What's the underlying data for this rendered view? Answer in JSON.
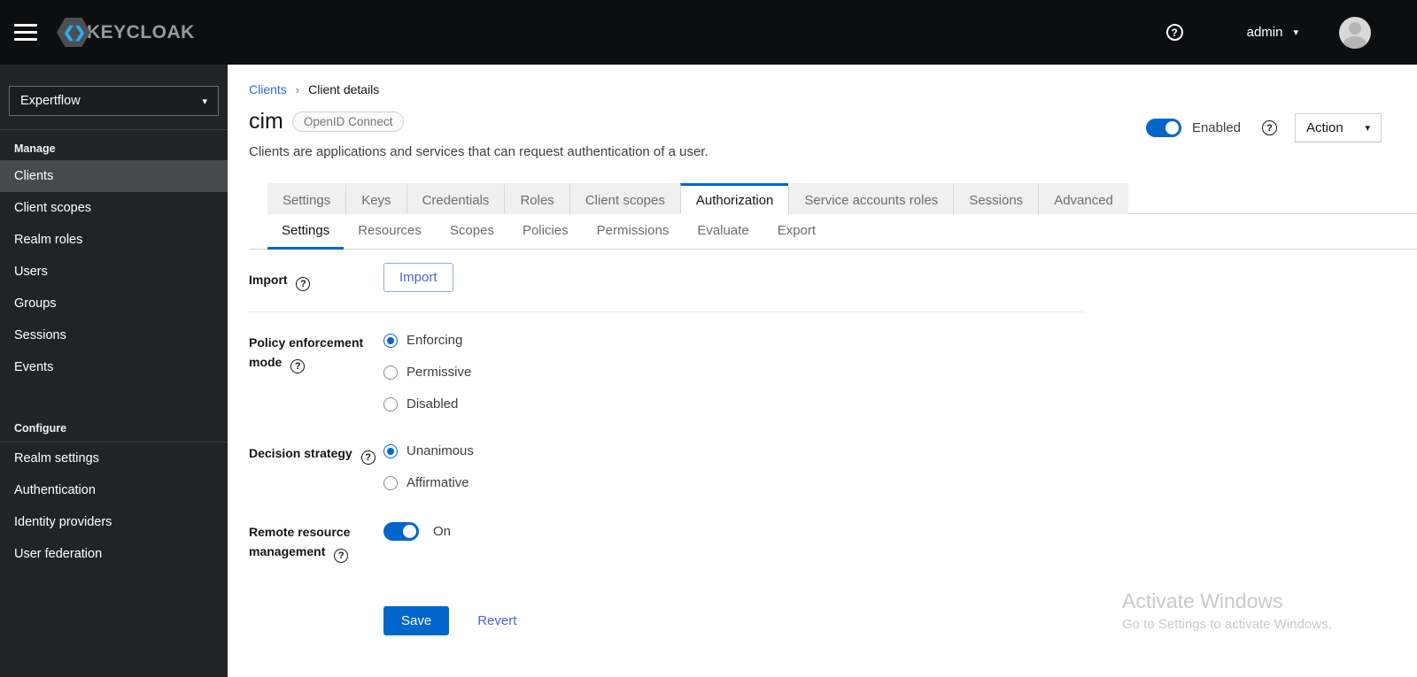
{
  "masthead": {
    "brand_glyph": "❮❯",
    "brand_word": "KEYCLOAK",
    "help_glyph": "?",
    "user_name": "admin",
    "caret_glyph": "▾"
  },
  "sidebar": {
    "realm_selector": {
      "value": "Expertflow",
      "caret_glyph": "▾"
    },
    "sections": [
      {
        "label": "Manage",
        "items": [
          {
            "label": "Clients",
            "active": true
          },
          {
            "label": "Client scopes",
            "active": false
          },
          {
            "label": "Realm roles",
            "active": false
          },
          {
            "label": "Users",
            "active": false
          },
          {
            "label": "Groups",
            "active": false
          },
          {
            "label": "Sessions",
            "active": false
          },
          {
            "label": "Events",
            "active": false
          }
        ]
      },
      {
        "label": "Configure",
        "items": [
          {
            "label": "Realm settings",
            "active": false
          },
          {
            "label": "Authentication",
            "active": false
          },
          {
            "label": "Identity providers",
            "active": false
          },
          {
            "label": "User federation",
            "active": false
          }
        ]
      }
    ]
  },
  "breadcrumb": {
    "link": "Clients",
    "separator": "›",
    "current": "Client details"
  },
  "header": {
    "title": "cim",
    "badge": "OpenID Connect",
    "description": "Clients are applications and services that can request authentication of a user.",
    "enabled_toggle": {
      "state": "on",
      "label": "Enabled"
    },
    "help_glyph": "?",
    "action_button": {
      "label": "Action",
      "caret_glyph": "▾"
    }
  },
  "tabs": {
    "active": "Authorization",
    "items": [
      {
        "label": "Settings"
      },
      {
        "label": "Keys"
      },
      {
        "label": "Credentials"
      },
      {
        "label": "Roles"
      },
      {
        "label": "Client scopes"
      },
      {
        "label": "Authorization"
      },
      {
        "label": "Service accounts roles"
      },
      {
        "label": "Sessions"
      },
      {
        "label": "Advanced"
      }
    ]
  },
  "subtabs": {
    "active": "Settings",
    "items": [
      {
        "label": "Settings"
      },
      {
        "label": "Resources"
      },
      {
        "label": "Scopes"
      },
      {
        "label": "Policies"
      },
      {
        "label": "Permissions"
      },
      {
        "label": "Evaluate"
      },
      {
        "label": "Export"
      }
    ]
  },
  "form": {
    "import": {
      "label": "Import",
      "help_glyph": "?",
      "button_label": "Import"
    },
    "policy_enforcement": {
      "label_line1": "Policy enforcement",
      "label_line2": "mode",
      "help_glyph": "?",
      "selected": "Enforcing",
      "options": [
        {
          "label": "Enforcing",
          "checked": true
        },
        {
          "label": "Permissive",
          "checked": false
        },
        {
          "label": "Disabled",
          "checked": false
        }
      ]
    },
    "decision_strategy": {
      "label": "Decision strategy",
      "help_glyph": "?",
      "selected": "Unanimous",
      "options": [
        {
          "label": "Unanimous",
          "checked": true
        },
        {
          "label": "Affirmative",
          "checked": false
        }
      ]
    },
    "remote_resource_management": {
      "label_line1": "Remote resource",
      "label_line2": "management",
      "help_glyph": "?",
      "toggle_state": "on",
      "state_label": "On"
    },
    "save_label": "Save",
    "revert_label": "Revert"
  },
  "watermark": {
    "line1": "Activate Windows",
    "line2": "Go to Settings to activate Windows."
  },
  "colors": {
    "accent": "#0066cc",
    "masthead_bg": "#0d0e10",
    "sidebar_bg": "#212427",
    "sidebar_active_bg": "#47494d",
    "tab_bg": "#f0f0f0",
    "border": "#d2d2d2",
    "link": "#2b6cd4",
    "secondary_blue": "#4a63d8",
    "muted_text": "#6a6e73"
  }
}
